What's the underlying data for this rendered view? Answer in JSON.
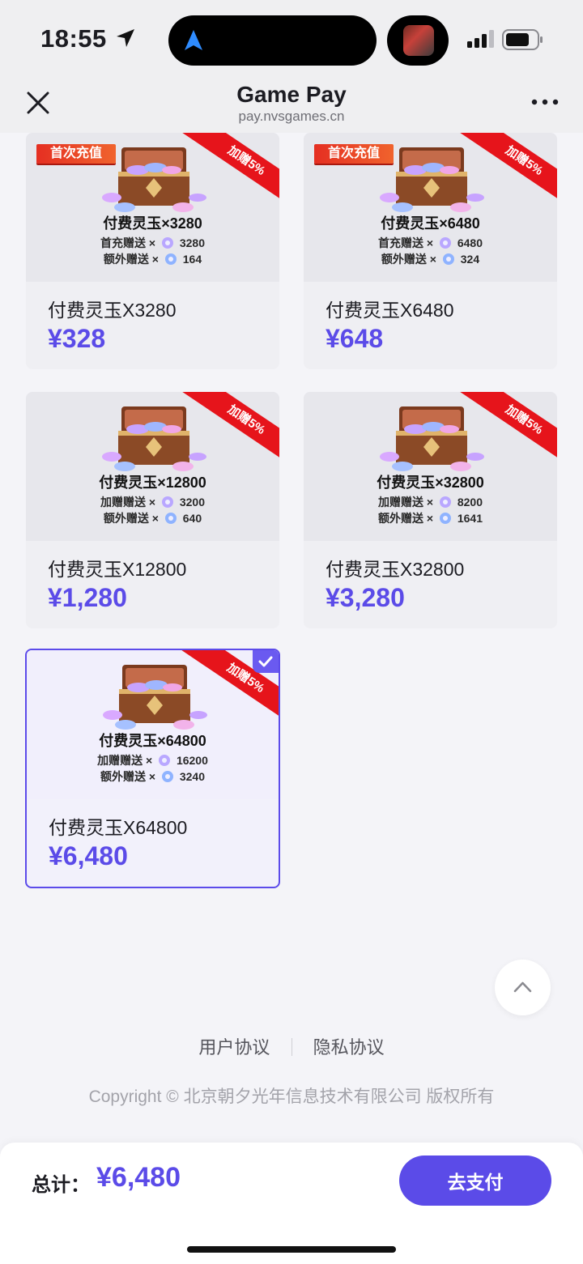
{
  "status_bar": {
    "time": "18:55"
  },
  "header": {
    "title": "Game Pay",
    "url": "pay.nvsgames.cn"
  },
  "products": [
    {
      "tag": "首次充值",
      "ribbon": "加赠5%",
      "banner_title": "付费灵玉×3280",
      "line1_label": "首充赠送 ×",
      "line1_value": "3280",
      "line2_label": "额外赠送 ×",
      "line2_value": "164",
      "name": "付费灵玉X3280",
      "price": "¥328",
      "selected": false
    },
    {
      "tag": "首次充值",
      "ribbon": "加赠5%",
      "banner_title": "付费灵玉×6480",
      "line1_label": "首充赠送 ×",
      "line1_value": "6480",
      "line2_label": "额外赠送 ×",
      "line2_value": "324",
      "name": "付费灵玉X6480",
      "price": "¥648",
      "selected": false
    },
    {
      "tag": "",
      "ribbon": "加赠5%",
      "banner_title": "付费灵玉×12800",
      "line1_label": "加赠赠送 ×",
      "line1_value": "3200",
      "line2_label": "额外赠送 ×",
      "line2_value": "640",
      "name": "付费灵玉X12800",
      "price": "¥1,280",
      "selected": false
    },
    {
      "tag": "",
      "ribbon": "加赠5%",
      "banner_title": "付费灵玉×32800",
      "line1_label": "加赠赠送 ×",
      "line1_value": "8200",
      "line2_label": "额外赠送 ×",
      "line2_value": "1641",
      "name": "付费灵玉X32800",
      "price": "¥3,280",
      "selected": false
    },
    {
      "tag": "",
      "ribbon": "加赠5%",
      "banner_title": "付费灵玉×64800",
      "line1_label": "加赠赠送 ×",
      "line1_value": "16200",
      "line2_label": "额外赠送 ×",
      "line2_value": "3240",
      "name": "付费灵玉X64800",
      "price": "¥6,480",
      "selected": true
    }
  ],
  "footer": {
    "user_agreement": "用户协议",
    "privacy_agreement": "隐私协议",
    "copyright": "Copyright © 北京朝夕光年信息技术有限公司 版权所有"
  },
  "pay_bar": {
    "total_label": "总计：",
    "total_value": "¥6,480",
    "pay_button": "去支付"
  },
  "colors": {
    "accent": "#5b4be8",
    "ribbon": "#e6141b",
    "tag": "#e52f22"
  },
  "icons": [
    "location-arrow-icon",
    "navigation-icon",
    "signal-icon",
    "battery-icon",
    "close-icon",
    "more-icon",
    "treasure-chest-icon",
    "jade-icon",
    "check-icon",
    "chevron-up-icon"
  ]
}
